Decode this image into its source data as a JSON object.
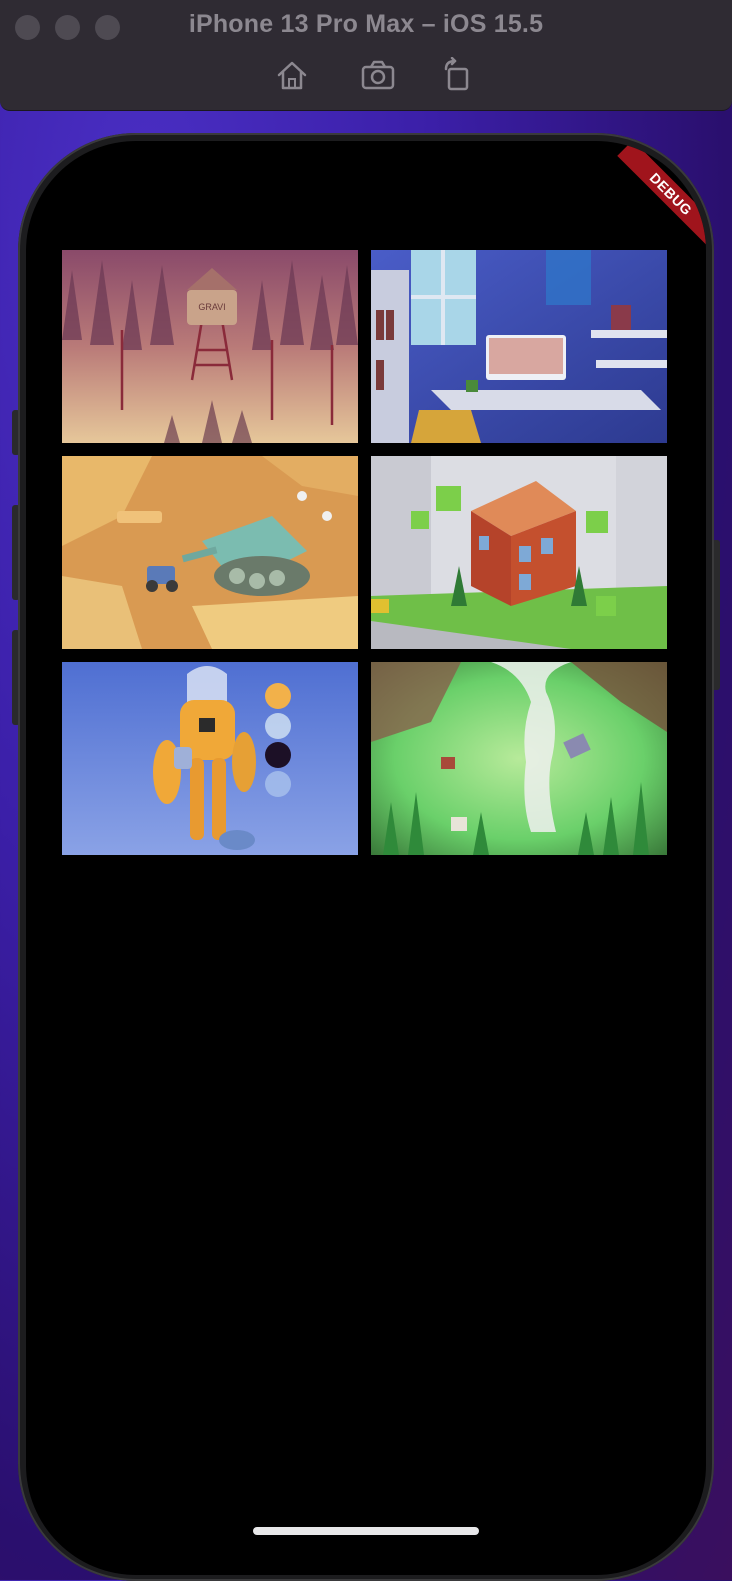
{
  "window": {
    "title": "iPhone 13 Pro Max – iOS 15.5",
    "toolbar": [
      {
        "icon": "home-icon"
      },
      {
        "icon": "camera-icon"
      },
      {
        "icon": "rotate-icon"
      }
    ]
  },
  "app": {
    "debug_banner": "DEBUG",
    "gallery": [
      {
        "name": "water-tower-scene"
      },
      {
        "name": "desk-room-scene"
      },
      {
        "name": "tank-desert-scene"
      },
      {
        "name": "red-house-scene"
      },
      {
        "name": "astronaut-character-scene"
      },
      {
        "name": "tornado-scene"
      }
    ]
  },
  "colors": {
    "debug": "#a0141c",
    "screen": "#000000",
    "simulator_bar": "#2f2b33"
  }
}
